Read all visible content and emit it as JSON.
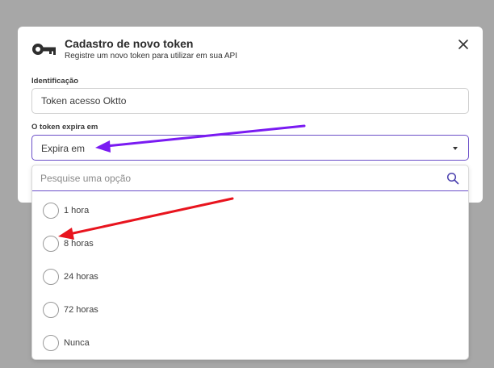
{
  "modal": {
    "title": "Cadastro de novo token",
    "subtitle": "Registre um novo token para utilizar em sua API",
    "close_icon": "close-icon",
    "header_icon": "key-icon"
  },
  "form": {
    "identificacao_label": "Identificação",
    "identificacao_value": "Token acesso Oktto",
    "expira_label": "O token expira em",
    "expira_value": "Expira em"
  },
  "dropdown": {
    "search_placeholder": "Pesquise uma opção",
    "search_icon": "search-icon",
    "options": [
      {
        "label": "1 hora",
        "selected": false
      },
      {
        "label": "8 horas",
        "selected": false
      },
      {
        "label": "24 horas",
        "selected": false
      },
      {
        "label": "72 horas",
        "selected": false
      },
      {
        "label": "Nunca",
        "selected": false
      }
    ]
  },
  "annotations": {
    "purple_arrow_color": "#7a1bf2",
    "red_arrow_color": "#e8141e"
  },
  "colors": {
    "accent": "#6b4fc8",
    "backdrop": "#a7a7a7"
  }
}
